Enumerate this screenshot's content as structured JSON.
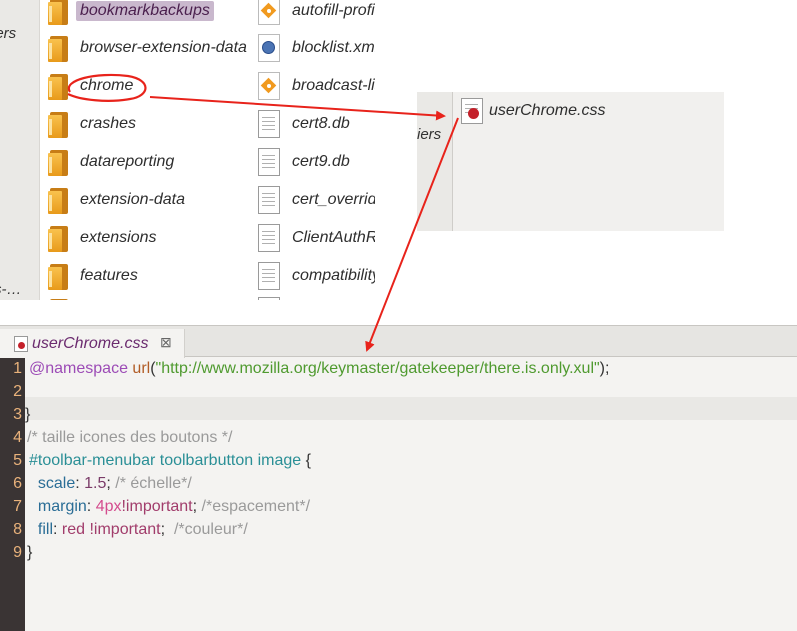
{
  "file_manager": {
    "sidebar_fragments": [
      "iers",
      "s-…"
    ],
    "column1": [
      {
        "name": "bookmarkbackups",
        "icon": "folder-icon",
        "selected": true
      },
      {
        "name": "browser-extension-data",
        "icon": "folder-icon"
      },
      {
        "name": "chrome",
        "icon": "folder-icon"
      },
      {
        "name": "crashes",
        "icon": "folder-icon"
      },
      {
        "name": "datareporting",
        "icon": "folder-icon"
      },
      {
        "name": "extension-data",
        "icon": "folder-icon"
      },
      {
        "name": "extensions",
        "icon": "folder-icon"
      },
      {
        "name": "features",
        "icon": "folder-icon"
      }
    ],
    "column2": [
      {
        "name": "autofill-profile",
        "icon": "diamond-file-icon"
      },
      {
        "name": "blocklist.xml",
        "icon": "globe-file-icon"
      },
      {
        "name": "broadcast-lis",
        "icon": "diamond-file-icon"
      },
      {
        "name": "cert8.db",
        "icon": "document-icon"
      },
      {
        "name": "cert9.db",
        "icon": "document-icon"
      },
      {
        "name": "cert_override",
        "icon": "document-icon"
      },
      {
        "name": "ClientAuthRe",
        "icon": "document-icon"
      },
      {
        "name": "compatibility.",
        "icon": "document-icon"
      }
    ]
  },
  "popup": {
    "sidebar_fragment": "iers",
    "file_name": "userChrome.css"
  },
  "editor": {
    "tab_title": "userChrome.css",
    "tab_close": "⊠",
    "line_numbers": [
      "1",
      "2",
      "3",
      "4",
      "5",
      "6",
      "7",
      "8",
      "9"
    ],
    "lines": {
      "l1": {
        "at": "@namespace",
        "fn": "url",
        "open": "(",
        "str": "\"http://www.mozilla.org/keymaster/gatekeeper/there.is.only.xul\"",
        "close": ");"
      },
      "l3": {
        "text": "}"
      },
      "l4": {
        "comment": "/* taille icones des boutons */"
      },
      "l5": {
        "selector": "#toolbar-menubar",
        "selector2": "toolbarbutton image",
        "brace": " {"
      },
      "l6": {
        "prop": "scale",
        "value": "1.5",
        "comment": "/* échelle*/"
      },
      "l7": {
        "prop": "margin",
        "num": "4px",
        "imp": "!important",
        "comment": "/*espacement*/"
      },
      "l8": {
        "prop": "fill",
        "value": "red",
        "imp": "!important",
        "comment": "/*couleur*/"
      },
      "l9": {
        "text": "}"
      }
    }
  },
  "colors": {
    "annotation": "#e8231b",
    "selection": "#c9b8cd",
    "gutter": "#3a3434"
  }
}
